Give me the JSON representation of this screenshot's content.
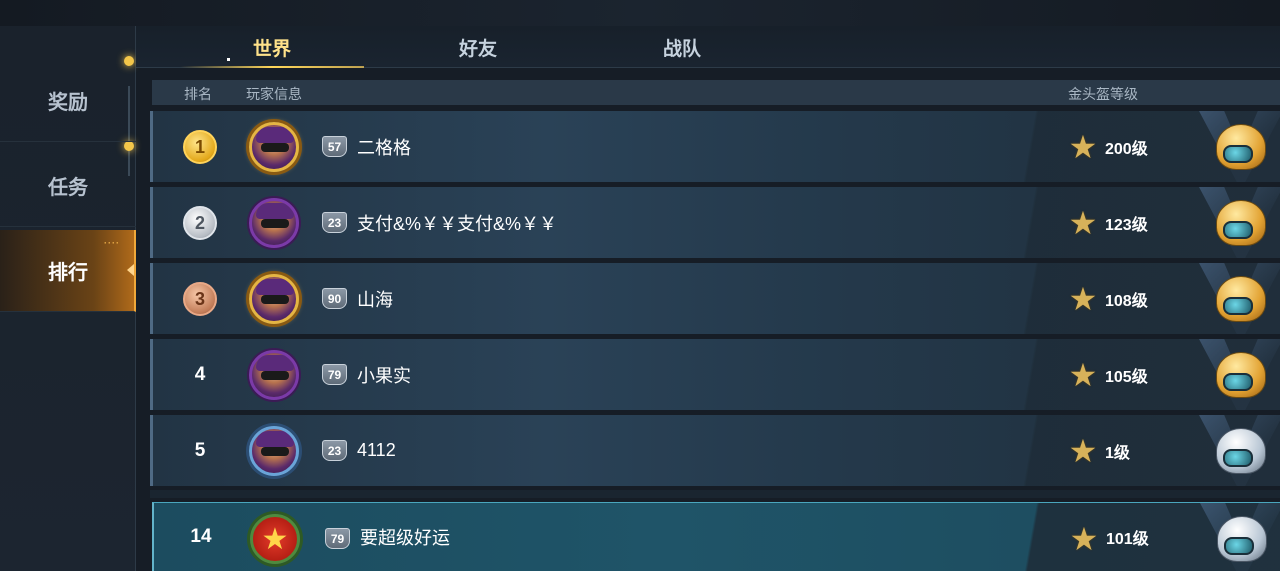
{
  "sidebar": {
    "items": [
      {
        "label": "奖励"
      },
      {
        "label": "任务"
      },
      {
        "label": "排行",
        "active": true
      }
    ]
  },
  "tabs": [
    {
      "label": "世界",
      "active": true
    },
    {
      "label": "好友"
    },
    {
      "label": "战队"
    }
  ],
  "columns": {
    "rank": "排名",
    "player": "玩家信息",
    "helmet_level": "金头盔等级"
  },
  "rows": [
    {
      "rank": "1",
      "medal": "gold",
      "level": "57",
      "name": "二格格",
      "helmet_level": "200级",
      "helmet": "gold",
      "avatar_frame": "gold-frame"
    },
    {
      "rank": "2",
      "medal": "silver",
      "level": "23",
      "name": "支付&%￥￥支付&%￥￥",
      "helmet_level": "123级",
      "helmet": "gold",
      "avatar_frame": "purple-frame"
    },
    {
      "rank": "3",
      "medal": "bronze",
      "level": "90",
      "name": "山海",
      "helmet_level": "108级",
      "helmet": "gold",
      "avatar_frame": "gold-frame"
    },
    {
      "rank": "4",
      "level": "79",
      "name": "小果实",
      "helmet_level": "105级",
      "helmet": "gold",
      "avatar_frame": "purple-frame"
    },
    {
      "rank": "5",
      "level": "23",
      "name": "4112",
      "helmet_level": "1级",
      "helmet": "silver",
      "avatar_frame": "blue-frame"
    }
  ],
  "my_row": {
    "rank": "14",
    "level": "79",
    "name": "要超级好运",
    "helmet_level": "101级",
    "helmet": "silver",
    "avatar_frame": "star-frame"
  },
  "icons": {
    "star": "★",
    "avatar_star": "★"
  },
  "colors": {
    "accent_gold": "#ffd75a",
    "active_tab": "#ffe28a",
    "sidebar_active": "#b06a1a"
  }
}
